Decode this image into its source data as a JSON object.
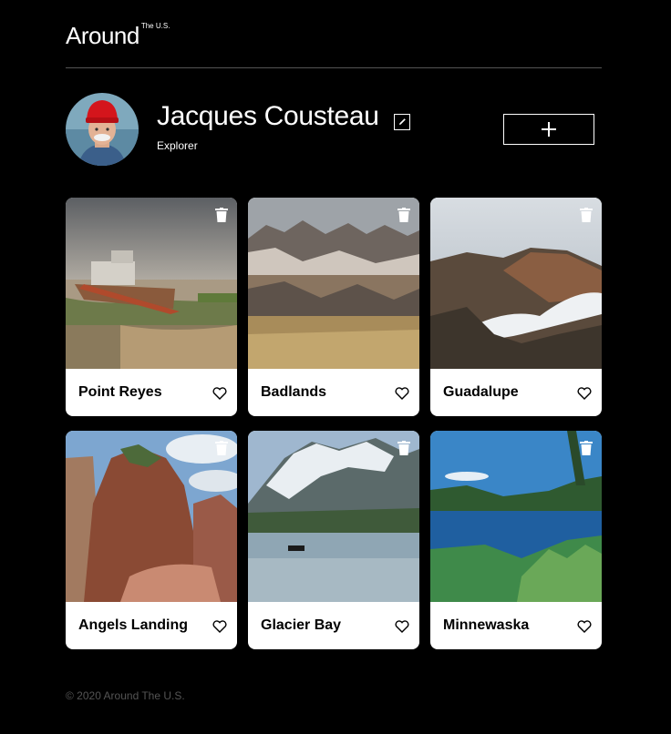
{
  "header": {
    "logo_main": "Around",
    "logo_sup": "The U.S."
  },
  "profile": {
    "name": "Jacques Cousteau",
    "about": "Explorer"
  },
  "cards": [
    {
      "title": "Point Reyes"
    },
    {
      "title": "Badlands"
    },
    {
      "title": "Guadalupe"
    },
    {
      "title": "Angels Landing"
    },
    {
      "title": "Glacier Bay"
    },
    {
      "title": "Minnewaska"
    }
  ],
  "footer": {
    "copyright": "© 2020 Around The U.S."
  },
  "icons": {
    "edit": "pencil-icon",
    "add": "plus-icon",
    "delete": "trash-icon",
    "like": "heart-icon"
  },
  "colors": {
    "background": "#000000",
    "card": "#ffffff",
    "footer_text": "#545454",
    "divider": "#545454"
  }
}
